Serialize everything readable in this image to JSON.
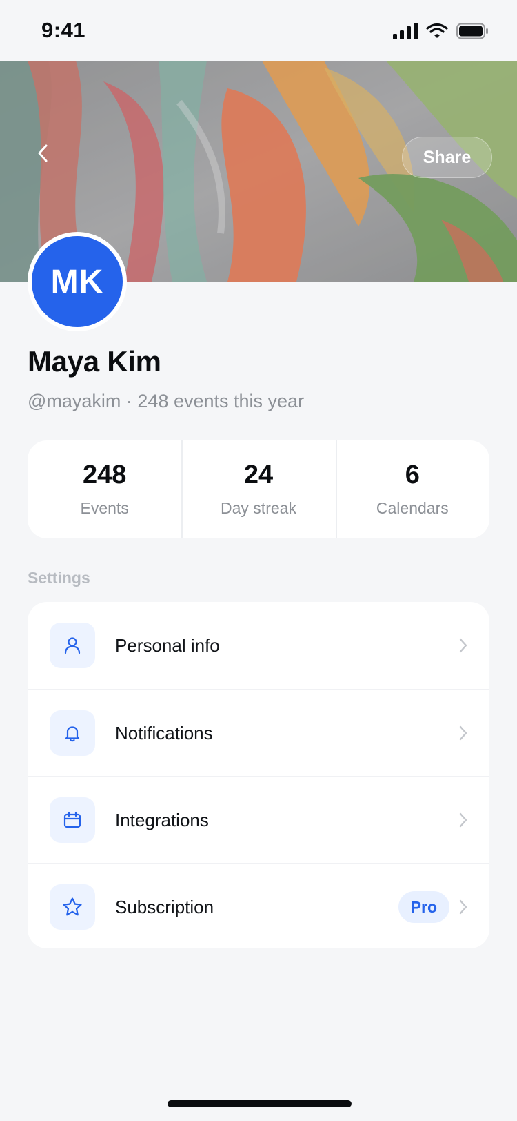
{
  "status_bar": {
    "time": "9:41",
    "icons": [
      "signal-icon",
      "wifi-icon",
      "battery-icon"
    ]
  },
  "header": {
    "back_icon": "chevron-left-icon",
    "share_label": "Share"
  },
  "profile": {
    "initials": "MK",
    "name": "Maya Kim",
    "subtitle": "@mayakim · 248 events this year",
    "avatar_color": "#2563eb"
  },
  "stats": [
    {
      "value": "248",
      "label": "Events"
    },
    {
      "value": "24",
      "label": "Day streak"
    },
    {
      "value": "6",
      "label": "Calendars"
    }
  ],
  "settings": {
    "section_label": "Settings",
    "items": [
      {
        "label": "Personal info",
        "icon": "user-icon"
      },
      {
        "label": "Notifications",
        "icon": "bell-icon"
      },
      {
        "label": "Integrations",
        "icon": "calendar-icon"
      },
      {
        "label": "Subscription",
        "icon": "star-icon",
        "badge": "Pro"
      }
    ]
  },
  "colors": {
    "accent": "#2563eb",
    "background": "#f5f6f8",
    "card": "#ffffff",
    "muted_text": "#8c9096"
  }
}
